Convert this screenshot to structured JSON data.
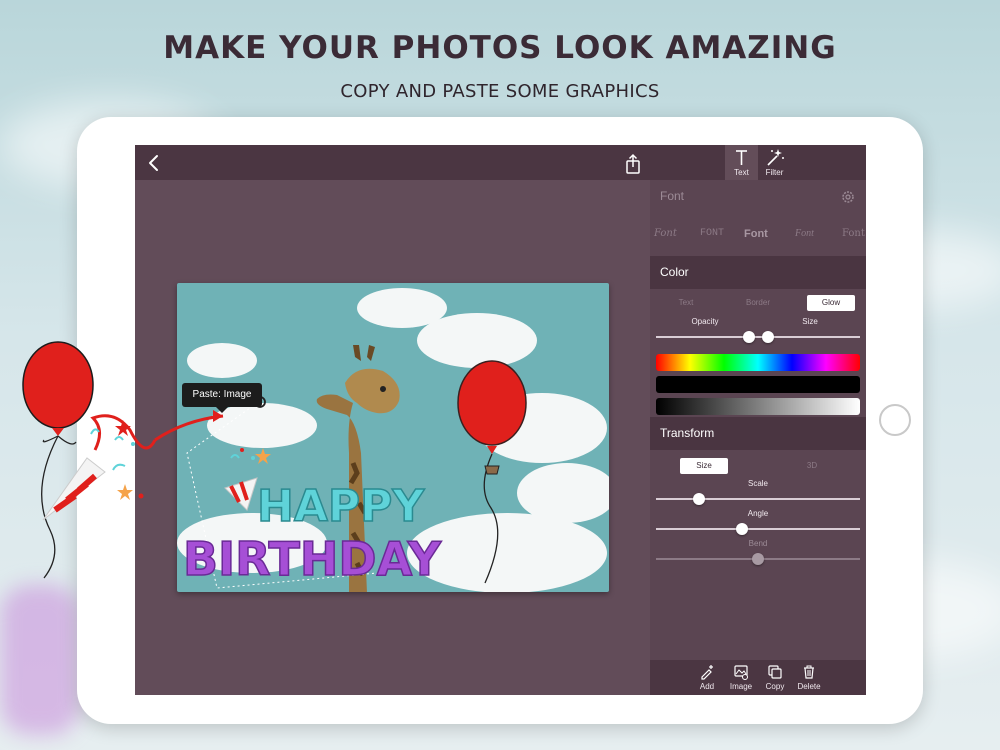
{
  "marketing": {
    "headline": "MAKE YOUR PHOTOS LOOK AMAZING",
    "subline": "COPY AND PASTE SOME GRAPHICS"
  },
  "toolbar": {
    "back_icon": "chevron-left-icon",
    "share_icon": "share-icon",
    "text_tab": "Text",
    "filter_tab": "Filter"
  },
  "canvas": {
    "paste_tooltip": "Paste: Image",
    "happy_text": "HAPPY",
    "birthday_text": "BIRTHDAY"
  },
  "panel": {
    "font_section": "Font",
    "font_samples": [
      "Font",
      "FONT",
      "Font",
      "Font",
      "Font"
    ],
    "color_section": "Color",
    "color_modes": [
      "Text",
      "Border",
      "Glow"
    ],
    "color_mode_selected": "Glow",
    "opacity_label": "Opacity",
    "size_label": "Size",
    "transform_section": "Transform",
    "transform_modes": [
      "Size",
      "3D"
    ],
    "scale_label": "Scale",
    "angle_label": "Angle",
    "bend_label": "Bend"
  },
  "bottom_bar": {
    "add": "Add",
    "image": "Image",
    "copy": "Copy",
    "delete": "Delete"
  },
  "colors": {
    "screen_bg": "#624c59",
    "topbar_bg": "#4b3642",
    "panel_bg": "#5b4552",
    "happy": "#5fd3d9",
    "birthday": "#a64fd6",
    "balloon": "#e0201c"
  }
}
